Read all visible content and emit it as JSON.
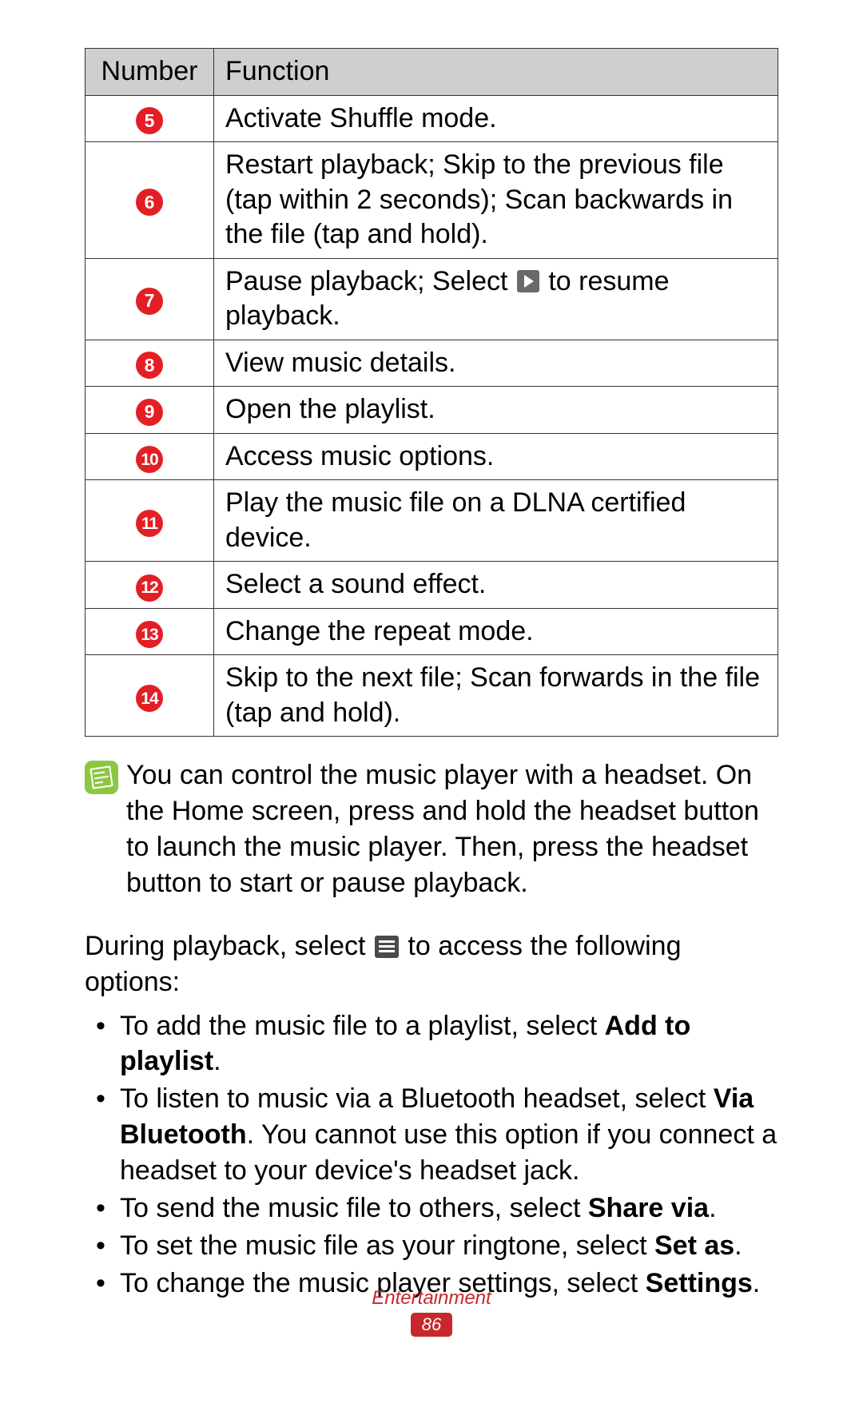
{
  "table": {
    "headers": {
      "number": "Number",
      "function": "Function"
    },
    "rows": [
      {
        "num": "5",
        "text": "Activate Shuffle mode."
      },
      {
        "num": "6",
        "text": "Restart playback; Skip to the previous file (tap within 2 seconds); Scan backwards in the file (tap and hold)."
      },
      {
        "num": "7",
        "text_before": "Pause playback; Select ",
        "has_play_icon": true,
        "text_after": " to resume playback."
      },
      {
        "num": "8",
        "text": "View music details."
      },
      {
        "num": "9",
        "text": "Open the playlist."
      },
      {
        "num": "10",
        "text": "Access music options."
      },
      {
        "num": "11",
        "text": "Play the music file on a DLNA certified device."
      },
      {
        "num": "12",
        "text": "Select a sound effect."
      },
      {
        "num": "13",
        "text": "Change the repeat mode."
      },
      {
        "num": "14",
        "text": "Skip to the next file; Scan forwards in the file (tap and hold)."
      }
    ]
  },
  "note": {
    "text": "You can control the music player with a headset. On the Home screen, press and hold the headset button to launch the music player. Then, press the headset button to start or pause playback."
  },
  "intro": {
    "before": "During playback, select ",
    "after": " to access the following options:"
  },
  "bullets": [
    {
      "pre": "To add the music file to a playlist, select ",
      "bold": "Add to playlist",
      "post": "."
    },
    {
      "pre": "To listen to music via a Bluetooth headset, select ",
      "bold": "Via Bluetooth",
      "post": ". You cannot use this option if you connect a headset to your device's headset jack."
    },
    {
      "pre": "To send the music file to others, select ",
      "bold": "Share via",
      "post": "."
    },
    {
      "pre": "To set the music file as your ringtone, select ",
      "bold": "Set as",
      "post": "."
    },
    {
      "pre": "To change the music player settings, select ",
      "bold": "Settings",
      "post": "."
    }
  ],
  "footer": {
    "section": "Entertainment",
    "page": "86"
  }
}
